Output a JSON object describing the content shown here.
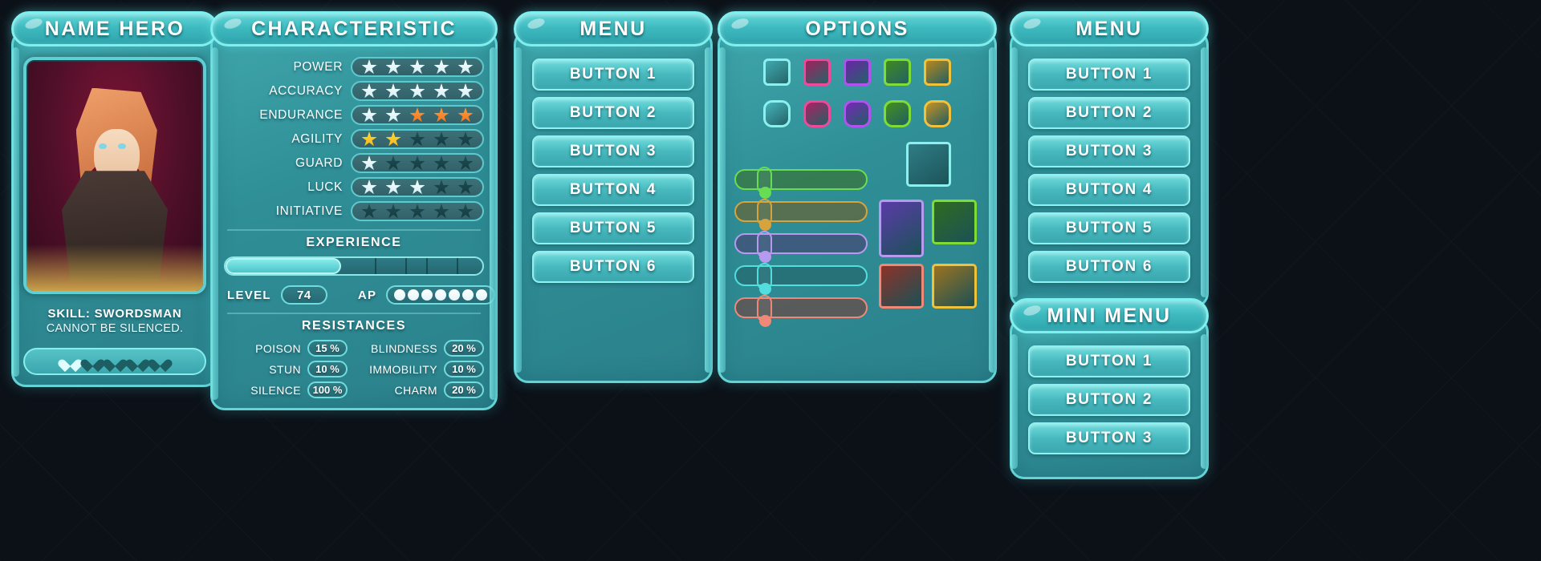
{
  "hero": {
    "title": "NAME HERO",
    "skill_title": "SKILL: SWORDSMAN",
    "skill_desc": "CANNOT BE SILENCED.",
    "hearts_total": 5,
    "hearts_filled": 1
  },
  "characteristic": {
    "title": "CHARACTERISTIC",
    "stats": [
      {
        "name": "POWER",
        "white": 5,
        "orange": 0,
        "yellow": 0,
        "total": 5
      },
      {
        "name": "ACCURACY",
        "white": 5,
        "orange": 0,
        "yellow": 0,
        "total": 5
      },
      {
        "name": "ENDURANCE",
        "white": 2,
        "orange": 3,
        "yellow": 0,
        "total": 5
      },
      {
        "name": "AGILITY",
        "white": 0,
        "orange": 0,
        "yellow": 2,
        "total": 5
      },
      {
        "name": "GUARD",
        "white": 1,
        "orange": 0,
        "yellow": 0,
        "total": 5
      },
      {
        "name": "LUCK",
        "white": 3,
        "orange": 0,
        "yellow": 0,
        "total": 5
      },
      {
        "name": "INITIATIVE",
        "white": 0,
        "orange": 0,
        "yellow": 0,
        "total": 5
      }
    ],
    "experience_label": "EXPERIENCE",
    "experience_percent": 45,
    "level_label": "LEVEL",
    "level_value": "74",
    "ap_label": "AP",
    "ap_dots": 7,
    "resistances_label": "RESISTANCES",
    "resistances": [
      {
        "name": "POISON",
        "value": "15 %"
      },
      {
        "name": "BLINDNESS",
        "value": "20 %"
      },
      {
        "name": "STUN",
        "value": "10 %"
      },
      {
        "name": "IMMOBILITY",
        "value": "10 %"
      },
      {
        "name": "SILENCE",
        "value": "100 %"
      },
      {
        "name": "CHARM",
        "value": "20 %"
      }
    ]
  },
  "menu": {
    "title": "MENU",
    "buttons": [
      "BUTTON 1",
      "BUTTON 2",
      "BUTTON 3",
      "BUTTON 4",
      "BUTTON 5",
      "BUTTON 6"
    ]
  },
  "menu2": {
    "title": "MENU",
    "buttons": [
      "BUTTON 1",
      "BUTTON 2",
      "BUTTON 3",
      "BUTTON 4",
      "BUTTON 5",
      "BUTTON 6"
    ]
  },
  "mini_menu": {
    "title": "MINI MENU",
    "buttons": [
      "BUTTON 1",
      "BUTTON 2",
      "BUTTON 3"
    ]
  },
  "options": {
    "title": "OPTIONS",
    "square_swatches": [
      {
        "name": "teal",
        "fill": "#3fa8ae",
        "border": "#8bf0ee"
      },
      {
        "name": "magenta",
        "fill": "#a31f5c",
        "border": "#f0489a"
      },
      {
        "name": "purple",
        "fill": "#6b23a8",
        "border": "#b152f0"
      },
      {
        "name": "green",
        "fill": "#3f8a1c",
        "border": "#7fdc35"
      },
      {
        "name": "gold",
        "fill": "#b8861a",
        "border": "#f0c23c"
      }
    ],
    "round_swatches": [
      {
        "name": "teal",
        "fill": "#45b4ba",
        "border": "#8bf0ee"
      },
      {
        "name": "magenta",
        "fill": "#b01f63",
        "border": "#f0489a"
      },
      {
        "name": "purple",
        "fill": "#7726b8",
        "border": "#b152f0"
      },
      {
        "name": "green",
        "fill": "#458f1d",
        "border": "#7fdc35"
      },
      {
        "name": "gold",
        "fill": "#c89221",
        "border": "#f0c23c"
      }
    ],
    "sliders": [
      {
        "name": "green",
        "color": "#66dd55",
        "fill": "rgba(60,110,30,.55)"
      },
      {
        "name": "gold",
        "color": "#d6a33c",
        "fill": "rgba(120,90,25,.55)"
      },
      {
        "name": "purple",
        "color": "#b79af0",
        "fill": "rgba(75,55,110,.55)"
      },
      {
        "name": "teal",
        "color": "#52dede",
        "fill": "rgba(35,95,100,.55)"
      },
      {
        "name": "red",
        "color": "#f08878",
        "fill": "rgba(125,55,48,.55)"
      }
    ],
    "icon_boxes": [
      {
        "name": "teal-box",
        "fill": "#2f7d86",
        "border": "#8bf0ee"
      },
      {
        "name": "purple-box",
        "fill": "#5b3aa8",
        "border": "#b79af0"
      },
      {
        "name": "green-box",
        "fill": "#2e6b1e",
        "border": "#7fdc35"
      },
      {
        "name": "red-box",
        "fill": "#8c3228",
        "border": "#f08878"
      },
      {
        "name": "gold-box",
        "fill": "#9a7320",
        "border": "#f0c23c"
      }
    ]
  }
}
